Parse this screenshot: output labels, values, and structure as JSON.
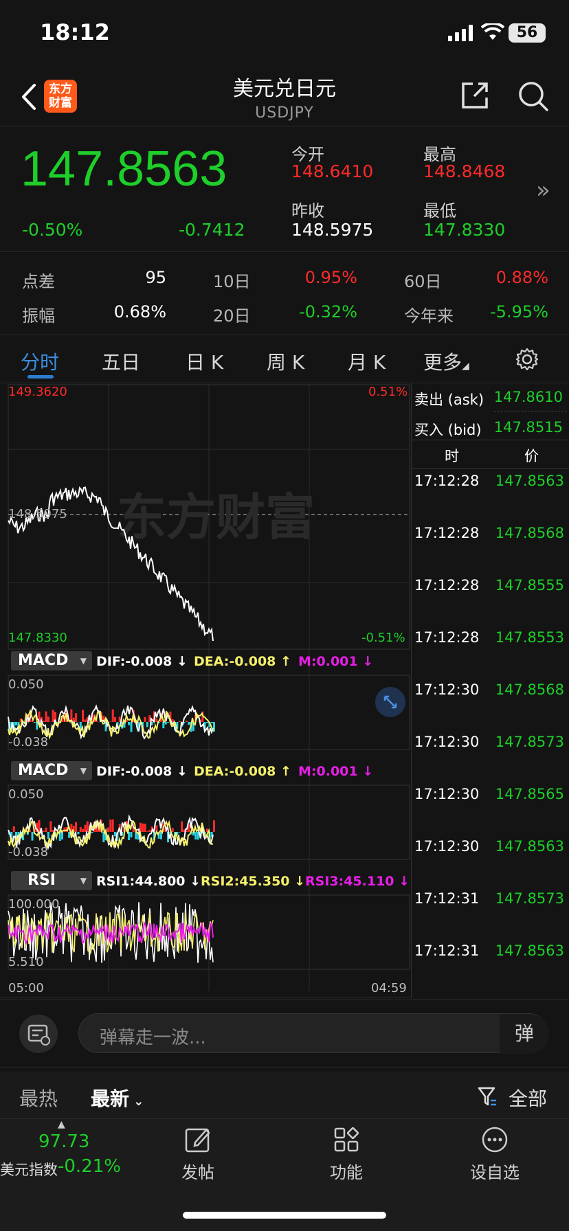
{
  "status": {
    "time": "18:12",
    "battery": "56"
  },
  "header": {
    "logo_text_1": "东方",
    "logo_text_2": "财富",
    "title": "美元兑日元",
    "subtitle": "USDJPY"
  },
  "quote": {
    "price": "147.8563",
    "change_pct": "-0.50%",
    "change_abs": "-0.7412",
    "open_label": "今开",
    "open": "148.6410",
    "high_label": "最高",
    "high": "148.8468",
    "prev_close_label": "昨收",
    "prev_close": "148.5975",
    "low_label": "最低",
    "low": "147.8330"
  },
  "stats": {
    "spread_label": "点差",
    "spread": "95",
    "d10_label": "10日",
    "d10": "0.95%",
    "d60_label": "60日",
    "d60": "0.88%",
    "amp_label": "振幅",
    "amp": "0.68%",
    "d20_label": "20日",
    "d20": "-0.32%",
    "ytd_label": "今年来",
    "ytd": "-5.95%"
  },
  "tabs": [
    "分时",
    "五日",
    "日 K",
    "周 K",
    "月 K",
    "更多"
  ],
  "chart": {
    "y_top": "149.3620",
    "y_mid": "148.5975",
    "y_bottom": "147.8330",
    "pct_top": "0.51%",
    "pct_bottom": "-0.51%",
    "watermark": "东方财富",
    "x_start": "05:00",
    "x_end": "04:59",
    "macd1": {
      "name": "MACD",
      "dif": "DIF:-0.008 ↓",
      "dea": "DEA:-0.008 ↑",
      "m": "M:0.001 ↓",
      "top": "0.050",
      "bottom": "-0.038"
    },
    "macd2": {
      "name": "MACD",
      "dif": "DIF:-0.008 ↓",
      "dea": "DEA:-0.008 ↑",
      "m": "M:0.001 ↓",
      "top": "0.050",
      "bottom": "-0.038"
    },
    "rsi": {
      "name": "RSI",
      "rsi1": "RSI1:44.800 ↓",
      "rsi2": "RSI2:45.350 ↓",
      "rsi3": "RSI3:45.110 ↓",
      "top": "100.000",
      "bottom": "5.510"
    }
  },
  "ticks": {
    "ask_label": "卖出 (ask)",
    "ask": "147.8610",
    "bid_label": "买入 (bid)",
    "bid": "147.8515",
    "col_time": "时",
    "col_price": "价",
    "rows": [
      {
        "time": "17:12:28",
        "price": "147.8563"
      },
      {
        "time": "17:12:28",
        "price": "147.8568"
      },
      {
        "time": "17:12:28",
        "price": "147.8555"
      },
      {
        "time": "17:12:28",
        "price": "147.8553"
      },
      {
        "time": "17:12:30",
        "price": "147.8568"
      },
      {
        "time": "17:12:30",
        "price": "147.8573"
      },
      {
        "time": "17:12:30",
        "price": "147.8565"
      },
      {
        "time": "17:12:30",
        "price": "147.8563"
      },
      {
        "time": "17:12:31",
        "price": "147.8573"
      },
      {
        "time": "17:12:31",
        "price": "147.8563"
      }
    ]
  },
  "danmu": {
    "placeholder": "弹幕走一波...",
    "send": "弹"
  },
  "feed": {
    "hot": "最热",
    "new": "最新",
    "all": "全部"
  },
  "bottom": {
    "index_value": "97.73",
    "index_name": "美元指数",
    "index_change": "-0.21%",
    "post": "发帖",
    "functions": "功能",
    "watchlist": "设自选"
  }
}
